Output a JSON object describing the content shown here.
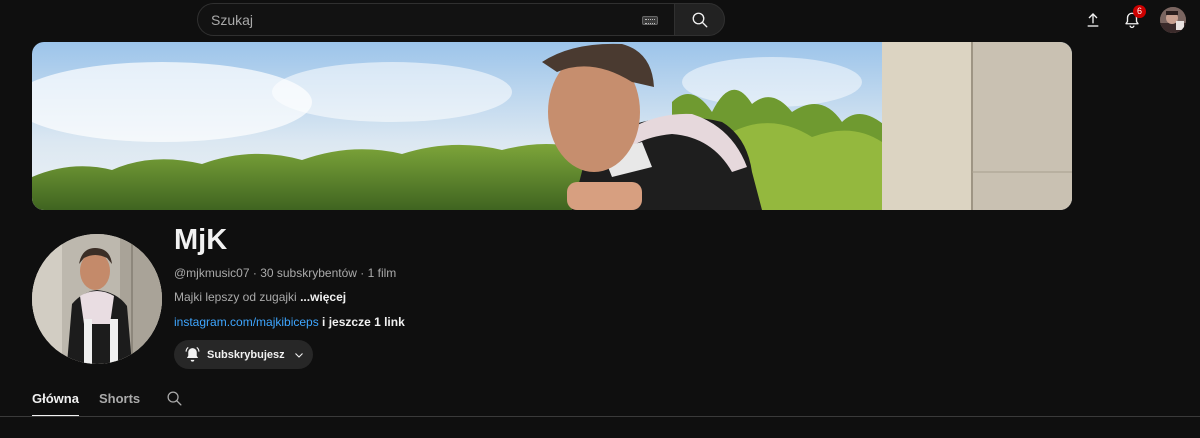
{
  "header": {
    "search_placeholder": "Szukaj",
    "notifications_count": "6"
  },
  "channel": {
    "name": "MjK",
    "handle": "@mjkmusic07",
    "separator": " · ",
    "subscribers": "30 subskrybentów",
    "videos": "1 film",
    "description": "Majki lepszy od zugajki ",
    "more_label": "...więcej",
    "link_text": "instagram.com/majkibiceps",
    "extra_links": " i jeszcze 1 link",
    "subscribe_label": "Subskrybujesz"
  },
  "tabs": [
    {
      "label": "Główna",
      "active": true
    },
    {
      "label": "Shorts",
      "active": false
    }
  ],
  "colors": {
    "background": "#0f0f0f",
    "link": "#3ea6ff",
    "badge": "#cc0000"
  }
}
